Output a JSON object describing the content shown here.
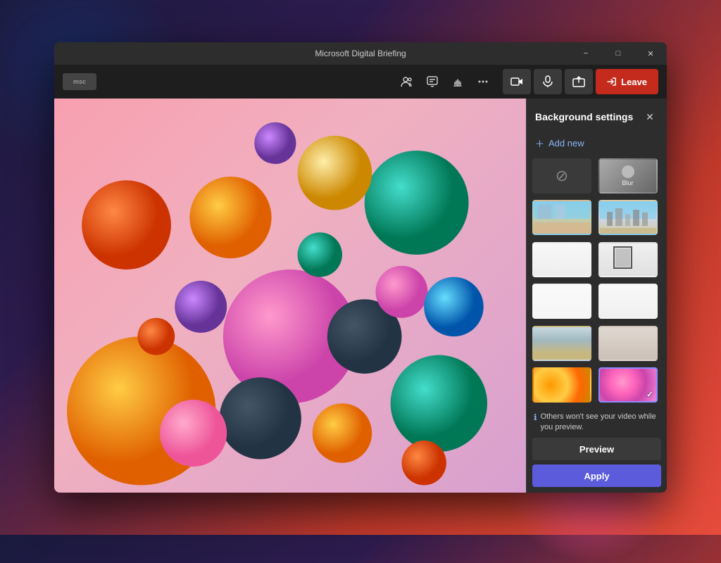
{
  "window": {
    "title": "Microsoft Digital Briefing",
    "controls": {
      "minimize": "−",
      "maximize": "□",
      "close": "✕"
    }
  },
  "toolbar": {
    "logo": "msc",
    "icons": [
      "people-icon",
      "chat-icon",
      "raise-hand-icon",
      "more-icon"
    ],
    "icon_symbols": [
      "👥",
      "💬",
      "✋",
      "···"
    ],
    "meeting_controls": {
      "camera_label": "📷",
      "mic_label": "🎤",
      "share_label": "⬆",
      "leave_label": "Leave"
    }
  },
  "background_settings": {
    "title": "Background settings",
    "add_new_label": "+ Add new",
    "info_text": "Others won't see your video while you preview.",
    "preview_label": "Preview",
    "apply_label": "Apply",
    "thumbnails": [
      {
        "id": "none",
        "label": "None",
        "type": "none"
      },
      {
        "id": "blur",
        "label": "Blur",
        "type": "blur"
      },
      {
        "id": "office1",
        "label": "",
        "type": "office-1"
      },
      {
        "id": "city",
        "label": "",
        "type": "city"
      },
      {
        "id": "white-room",
        "label": "",
        "type": "white-room-1"
      },
      {
        "id": "framed",
        "label": "",
        "type": "framed"
      },
      {
        "id": "white-minimal",
        "label": "",
        "type": "white-minimal"
      },
      {
        "id": "white-wall",
        "label": "",
        "type": "white-wall"
      },
      {
        "id": "modern-office",
        "label": "",
        "type": "modern-office"
      },
      {
        "id": "curtain",
        "label": "",
        "type": "curtain"
      },
      {
        "id": "balls-orange",
        "label": "",
        "type": "balls-orange"
      },
      {
        "id": "balls-pink",
        "label": "",
        "type": "balls-pink",
        "selected": true
      }
    ]
  }
}
